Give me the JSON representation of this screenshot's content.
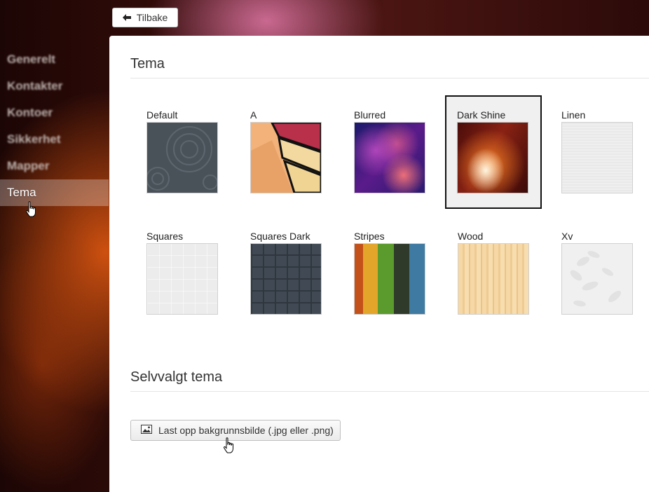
{
  "back_button": {
    "label": "Tilbake",
    "icon": "arrow-left-icon"
  },
  "sidebar": {
    "items": [
      {
        "label": "Generelt",
        "active": false
      },
      {
        "label": "Kontakter",
        "active": false
      },
      {
        "label": "Kontoer",
        "active": false
      },
      {
        "label": "Sikkerhet",
        "active": false
      },
      {
        "label": "Mapper",
        "active": false
      },
      {
        "label": "Tema",
        "active": true
      }
    ]
  },
  "theme_section": {
    "title": "Tema",
    "selected": "Dark Shine",
    "themes": [
      {
        "label": "Default"
      },
      {
        "label": "A"
      },
      {
        "label": "Blurred"
      },
      {
        "label": "Dark Shine"
      },
      {
        "label": "Linen"
      },
      {
        "label": "Squares"
      },
      {
        "label": "Squares Dark"
      },
      {
        "label": "Stripes"
      },
      {
        "label": "Wood"
      },
      {
        "label": "Xv"
      }
    ]
  },
  "custom_section": {
    "title": "Selvvalgt tema",
    "upload_button": {
      "label": "Last opp bakgrunnsbilde (.jpg eller .png)",
      "icon": "image-icon"
    }
  },
  "colors": {
    "panel_bg": "#ffffff",
    "selected_border": "#111111",
    "active_nav_bg": "rgba(255,255,255,0.28)"
  }
}
